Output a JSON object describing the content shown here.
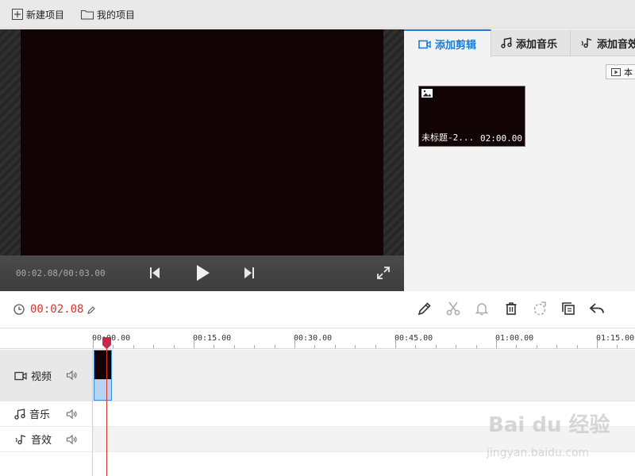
{
  "topbar": {
    "new_project": "新建项目",
    "my_projects": "我的项目"
  },
  "preview": {
    "timecode": "00:02.08/00:03.00"
  },
  "right_panel": {
    "tabs": [
      {
        "label": "添加剪辑",
        "icon": "video-camera-icon",
        "active": true
      },
      {
        "label": "添加音乐",
        "icon": "music-note-icon",
        "active": false
      },
      {
        "label": "添加音效",
        "icon": "sound-effect-icon",
        "active": false
      }
    ],
    "local_button": "本",
    "clip": {
      "name": "未标题-2...",
      "duration": "02:00.00"
    }
  },
  "timeline_toolbar": {
    "current_time": "00:02.08",
    "tools": [
      "pencil-icon",
      "scissors-icon",
      "bell-icon",
      "trash-icon",
      "crop-icon",
      "copy-icon",
      "undo-icon"
    ]
  },
  "ruler": {
    "labels": [
      "00:00.00",
      "00:15.00",
      "00:30.00",
      "00:45.00",
      "01:00.00",
      "01:15.00"
    ]
  },
  "tracks": [
    {
      "name": "视频",
      "icon": "video-camera-icon"
    },
    {
      "name": "音乐",
      "icon": "music-note-icon"
    },
    {
      "name": "音效",
      "icon": "sound-effect-icon"
    }
  ],
  "watermark": {
    "line1": "Bai du 经验",
    "line2": "jingyan.baidu.com"
  },
  "colors": {
    "accent_blue": "#1c7cd5",
    "playhead_red": "#d9342b",
    "screen_black": "#120305"
  }
}
